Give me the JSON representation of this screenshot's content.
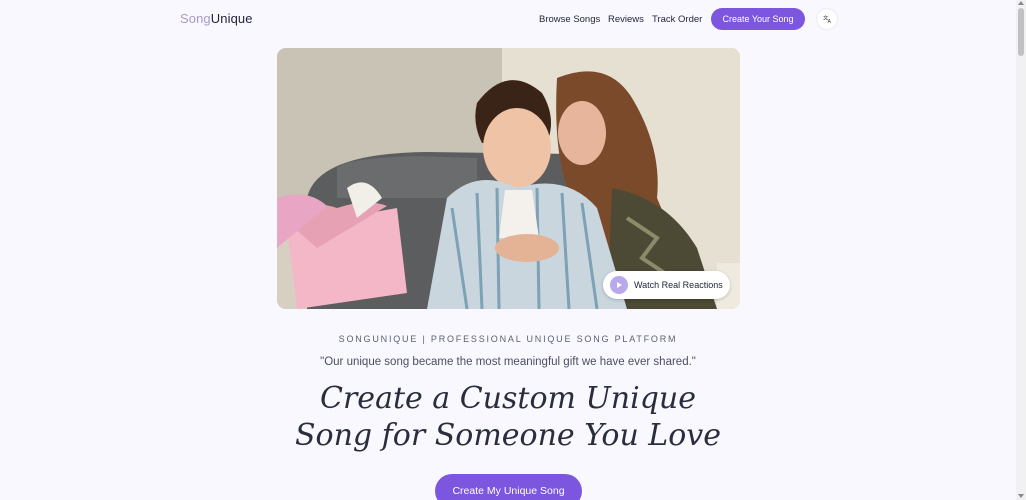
{
  "header": {
    "logo_part1": "Song",
    "logo_part2": "Unique",
    "nav": {
      "browse": "Browse Songs",
      "reviews": "Reviews",
      "track": "Track Order"
    },
    "cta": "Create Your Song",
    "language_icon": "translate-icon"
  },
  "video": {
    "watch_label": "Watch Real Reactions",
    "play_icon": "play-icon"
  },
  "hero": {
    "brand_line": "SONGUNIQUE | PROFESSIONAL UNIQUE SONG PLATFORM",
    "quote": "\"Our unique song became the most meaningful gift we have ever shared.\"",
    "headline_line1": "Create a Custom Unique",
    "headline_line2": "Song for Someone You Love",
    "cta": "Create My Unique Song"
  },
  "colors": {
    "accent": "#7d56e0",
    "logo_light": "#a79ac8",
    "background": "#faf8ff"
  }
}
